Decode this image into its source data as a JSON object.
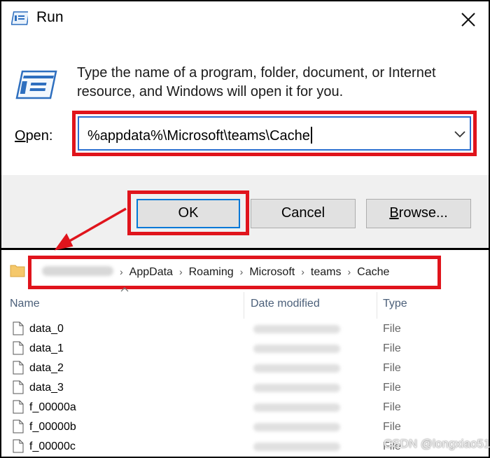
{
  "run_dialog": {
    "title": "Run",
    "description": "Type the name of a program, folder, document, or Internet resource, and Windows will open it for you.",
    "open_label_accel": "O",
    "open_label_rest": "pen:",
    "open_value": "%appdata%\\Microsoft\\teams\\Cache",
    "buttons": {
      "ok": "OK",
      "cancel": "Cancel",
      "browse_accel": "B",
      "browse_rest": "rowse..."
    }
  },
  "explorer": {
    "breadcrumb": [
      "AppData",
      "Roaming",
      "Microsoft",
      "teams",
      "Cache"
    ],
    "columns": {
      "name": "Name",
      "date": "Date modified",
      "type": "Type"
    },
    "files": [
      {
        "name": "data_0",
        "type": "File"
      },
      {
        "name": "data_1",
        "type": "File"
      },
      {
        "name": "data_2",
        "type": "File"
      },
      {
        "name": "data_3",
        "type": "File"
      },
      {
        "name": "f_00000a",
        "type": "File"
      },
      {
        "name": "f_00000b",
        "type": "File"
      },
      {
        "name": "f_00000c",
        "type": "File"
      }
    ]
  },
  "watermark": "CSDN @longxiao51",
  "colors": {
    "highlight": "#e0141c",
    "focus_blue": "#0078d7",
    "folder": "#f5c86b"
  },
  "icons": [
    "run-app-icon",
    "close-icon",
    "run-program-icon",
    "chevron-down-icon",
    "folder-icon",
    "sort-up-icon",
    "file-icon",
    "arrow-annotation"
  ]
}
